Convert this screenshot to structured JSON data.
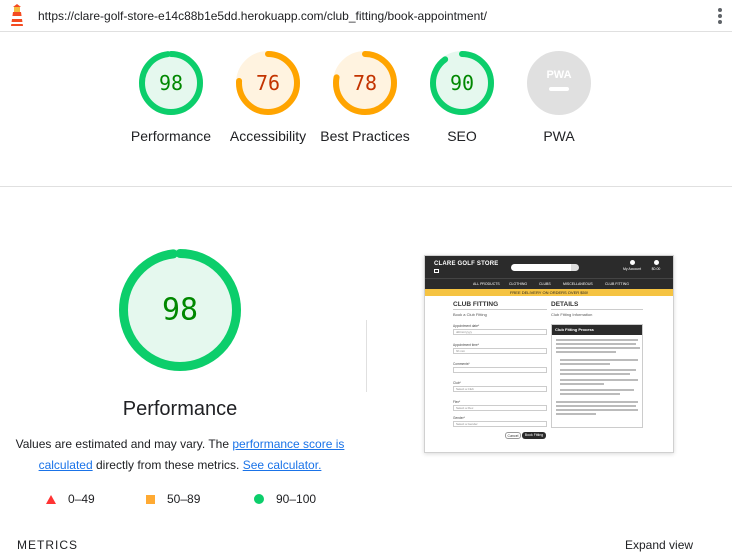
{
  "address_bar": {
    "url": "https://clare-golf-store-e14c88b1e5dd.herokuapp.com/club_fitting/book-appointment/",
    "logo_icon": "lighthouse-icon",
    "menu_icon": "kebab-menu-icon"
  },
  "colors": {
    "pass": "#0cce6b",
    "pass_text": "#008800",
    "pass_bg": "#e5f8ee",
    "average": "#ffa400",
    "average_text": "#c33300",
    "average_bg": "#fff3e0",
    "fail": "#ff3333",
    "na": "#e0e0e0",
    "link": "#1a73e8"
  },
  "scores": [
    {
      "label": "Performance",
      "value": "98",
      "score": 98,
      "rating": "pass"
    },
    {
      "label": "Accessibility",
      "value": "76",
      "score": 76,
      "rating": "average"
    },
    {
      "label": "Best Practices",
      "value": "78",
      "score": 78,
      "rating": "average"
    },
    {
      "label": "SEO",
      "value": "90",
      "score": 90,
      "rating": "pass"
    },
    {
      "label": "PWA",
      "value": "PWA",
      "score": null,
      "rating": "na"
    }
  ],
  "performance": {
    "score": "98",
    "score_value": 98,
    "title": "Performance",
    "desc_text_1": "Values are estimated and may vary. The ",
    "link_1": "performance score is calculated",
    "desc_text_2": " directly from these metrics. ",
    "link_2": "See calculator."
  },
  "legend": [
    {
      "icon": "triangle-icon",
      "range": "0–49"
    },
    {
      "icon": "square-icon",
      "range": "50–89"
    },
    {
      "icon": "circle-icon",
      "range": "90–100"
    }
  ],
  "thumbnail": {
    "logo": "CLARE GOLF STORE",
    "account_label": "My Account",
    "bag_label": "$0.00",
    "nav": [
      "ALL PRODUCTS",
      "CLOTHING",
      "CLUBS",
      "MISCELLANEOUS",
      "CLUB FITTING"
    ],
    "banner": "FREE DELIVERY ON ORDERS OVER $50!",
    "left_heading": "CLUB FITTING",
    "left_sub": "Book a Club Fitting",
    "right_heading": "DETAILS",
    "right_sub": "Club Fitting Information",
    "panel_title": "Club Fitting Process",
    "fields": [
      {
        "label": "Appointment date*",
        "value": "dd/mm/yyyy"
      },
      {
        "label": "Appointment time*",
        "value": "hh:mm"
      },
      {
        "label": "Comments*",
        "value": ""
      },
      {
        "label": "Club*",
        "value": "Select a Club"
      },
      {
        "label": "Flex*",
        "value": "Select a Flex"
      },
      {
        "label": "Gender*",
        "value": "Select a Gender"
      }
    ],
    "cancel_label": "Cancel",
    "submit_label": "Book Fitting"
  },
  "metrics_heading": "METRICS",
  "expand_label": "Expand view"
}
